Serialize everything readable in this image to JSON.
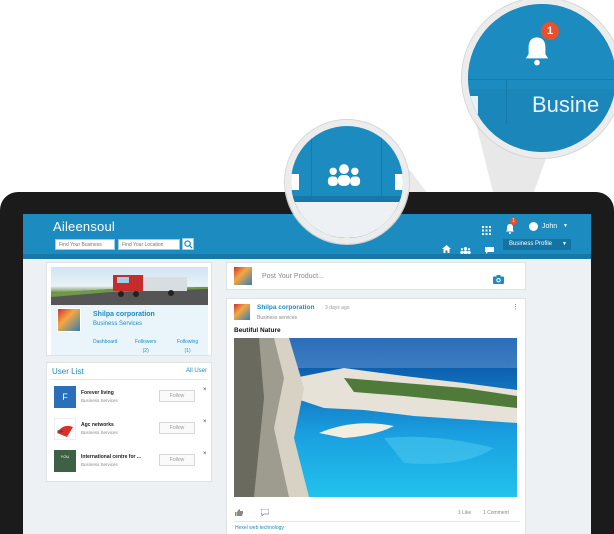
{
  "app": {
    "brand": "Aileensoul"
  },
  "header": {
    "search_business_placeholder": "Find Your Business",
    "search_location_placeholder": "Find Your Location",
    "notification_count": "1",
    "user_name": "John",
    "profile_menu": "Business Profile",
    "icons": [
      "apps-grid-icon",
      "bell-icon",
      "user-avatar-icon",
      "home-icon",
      "people-icon",
      "chat-icon",
      "caret-down-icon"
    ]
  },
  "zoom_notifications": {
    "badge": "1",
    "label": "Busine"
  },
  "profile_card": {
    "name": "Shilpa corporation",
    "type": "Business Services",
    "stats": [
      {
        "label": "Dashboard",
        "count": ""
      },
      {
        "label": "Followers",
        "count": "(2)"
      },
      {
        "label": "Following",
        "count": "(1)"
      }
    ]
  },
  "user_list": {
    "title": "User List",
    "all_link": "All User",
    "follow_label": "Follow",
    "close_label": "×",
    "items": [
      {
        "name": "Forever living",
        "type": "Business Services",
        "logo_letter": "F",
        "logo_color": "#2a6fb8"
      },
      {
        "name": "Agc networks",
        "type": "Business Services",
        "logo_letter": "",
        "logo_color": "#ffffff"
      },
      {
        "name": "International centre for ...",
        "type": "Business Services",
        "logo_letter": "YOU",
        "logo_color": "#3e6146"
      }
    ]
  },
  "composer": {
    "placeholder": "Post Your Product..."
  },
  "post": {
    "author": "Shilpa corporation",
    "time": "· 3 days ago",
    "author_type": "Business services",
    "title": "Beutiful Nature",
    "likes": "1 Like",
    "comments": "1 Comment",
    "next_author": "Hexel web technology"
  },
  "colors": {
    "brand": "#1b8bc0",
    "notif": "#e9502d"
  }
}
